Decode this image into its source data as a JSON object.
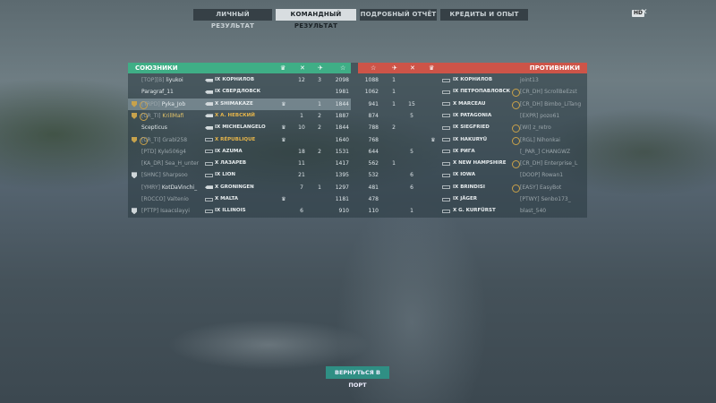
{
  "tabs": [
    {
      "label": "ЛИЧНЫЙ РЕЗУЛЬТАТ",
      "active": false
    },
    {
      "label": "КОМАНДНЫЙ РЕЗУЛЬТАТ",
      "active": true
    },
    {
      "label": "ПОДРОБНЫЙ ОТЧЁТ",
      "active": false
    },
    {
      "label": "КРЕДИТЫ И ОПЫТ",
      "active": false
    }
  ],
  "hd_label": "HD",
  "close_glyph": "✕",
  "allies_title": "СОЮЗНИКИ",
  "enemies_title": "ПРОТИВНИКИ",
  "column_icons": {
    "ribbons": "♛",
    "kills": "✕",
    "planes": "✈",
    "xp": "☆"
  },
  "allies": [
    {
      "clan": "[TOP][B]",
      "name": "liyukoi",
      "ship": "IX КОРНИЛОВ",
      "ribbons": "",
      "kills": "12",
      "planes": "3",
      "xp": "2098",
      "hl": false,
      "gold": false,
      "badge": "",
      "dim": false
    },
    {
      "clan": "",
      "name": "Paragraf_11",
      "ship": "IX СВЕРДЛОВСК",
      "ribbons": "",
      "kills": "",
      "planes": "",
      "xp": "1981",
      "hl": false,
      "gold": false,
      "badge": "",
      "dim": false
    },
    {
      "clan": "[TRPD]",
      "name": "Pyka_Job",
      "ship": "X SHIMAKAZE",
      "ribbons": "♛",
      "kills": "",
      "planes": "1",
      "xp": "1844",
      "hl": true,
      "gold": false,
      "badge": "shield",
      "dim": false
    },
    {
      "clan": "[CR_TI]",
      "name": "KrillMafi",
      "ship": "X A. НЕВСКИЙ",
      "ribbons": "",
      "kills": "1",
      "planes": "2",
      "xp": "1887",
      "hl": false,
      "gold": true,
      "badge": "shield",
      "dim": false
    },
    {
      "clan": "",
      "name": "Scepticus",
      "ship": "IX MICHELANGELO",
      "ribbons": "♛",
      "kills": "10",
      "planes": "2",
      "xp": "1844",
      "hl": false,
      "gold": false,
      "badge": "",
      "dim": false
    },
    {
      "clan": "[CR_TI]",
      "name": "Grabl258",
      "ship": "X RÉPUBLIQUE",
      "ribbons": "♛",
      "kills": "",
      "planes": "",
      "xp": "1640",
      "hl": false,
      "gold": true,
      "badge": "shield",
      "dim": true
    },
    {
      "clan": "[PTD]",
      "name": "Kyle506g4",
      "ship": "IX AZUMA",
      "ribbons": "",
      "kills": "18",
      "planes": "2",
      "xp": "1531",
      "hl": false,
      "gold": false,
      "badge": "",
      "dim": true
    },
    {
      "clan": "[KA_DR]",
      "name": "Sea_H_unter",
      "ship": "X ЛАЗАРЕВ",
      "ribbons": "",
      "kills": "11",
      "planes": "",
      "xp": "1417",
      "hl": false,
      "gold": false,
      "badge": "",
      "dim": true
    },
    {
      "clan": "[SHNC]",
      "name": "Sharpsoo",
      "ship": "IX LION",
      "ribbons": "",
      "kills": "21",
      "planes": "",
      "xp": "1395",
      "hl": false,
      "gold": false,
      "badge": "shieldw",
      "dim": true
    },
    {
      "clan": "[YMRY]",
      "name": "KotDaVinchi_",
      "ship": "X GRONINGEN",
      "ribbons": "",
      "kills": "7",
      "planes": "1",
      "xp": "1297",
      "hl": false,
      "gold": false,
      "badge": "",
      "dim": false
    },
    {
      "clan": "[ROCCO]",
      "name": "Valtenio",
      "ship": "X MALTA",
      "ribbons": "♛",
      "kills": "",
      "planes": "",
      "xp": "1181",
      "hl": false,
      "gold": false,
      "badge": "",
      "dim": true
    },
    {
      "clan": "[PTTP]",
      "name": "Isaacslayyi",
      "ship": "IX ILLINOIS",
      "ribbons": "",
      "kills": "6",
      "planes": "",
      "xp": "910",
      "hl": false,
      "gold": false,
      "badge": "shieldw",
      "dim": true
    }
  ],
  "enemies": [
    {
      "xp": "1088",
      "kills": "1",
      "planes": "",
      "ribbons": "",
      "ship": "IX КОРНИЛОВ",
      "clan": "",
      "name": "joint13"
    },
    {
      "xp": "1062",
      "kills": "1",
      "planes": "",
      "ribbons": "",
      "ship": "IX ПЕТРОПАВЛОВСК",
      "clan": "[CR_DH]",
      "name": "ScrollBeEzst"
    },
    {
      "xp": "941",
      "kills": "1",
      "planes": "15",
      "ribbons": "",
      "ship": "X MARCEAU",
      "clan": "[CR_DH]",
      "name": "Bimbo_LiTang"
    },
    {
      "xp": "874",
      "kills": "",
      "planes": "5",
      "ribbons": "",
      "ship": "IX PATAGONIA",
      "clan": "[EXPR]",
      "name": "pozo61"
    },
    {
      "xp": "788",
      "kills": "2",
      "planes": "",
      "ribbons": "",
      "ship": "IX SIEGFRIED",
      "clan": "[WI]",
      "name": "z_retro"
    },
    {
      "xp": "768",
      "kills": "",
      "planes": "",
      "ribbons": "♛",
      "ship": "IX HAKURYŪ",
      "clan": "[RGL]",
      "name": "Nihonkai"
    },
    {
      "xp": "644",
      "kills": "",
      "planes": "5",
      "ribbons": "",
      "ship": "IX РИГА",
      "clan": "[_PAR_]",
      "name": "CHANGWZ"
    },
    {
      "xp": "562",
      "kills": "1",
      "planes": "",
      "ribbons": "",
      "ship": "X NEW HAMPSHIRE",
      "clan": "[CR_DH]",
      "name": "Enterprise_L"
    },
    {
      "xp": "532",
      "kills": "",
      "planes": "6",
      "ribbons": "",
      "ship": "IX IOWA",
      "clan": "[DOOP]",
      "name": "Rowan1"
    },
    {
      "xp": "481",
      "kills": "",
      "planes": "6",
      "ribbons": "",
      "ship": "IX BRINDISI",
      "clan": "[EASY]",
      "name": "EasyBot"
    },
    {
      "xp": "478",
      "kills": "",
      "planes": "",
      "ribbons": "",
      "ship": "IX JÄGER",
      "clan": "[PTWY]",
      "name": "Senbo173_"
    },
    {
      "xp": "110",
      "kills": "",
      "planes": "1",
      "ribbons": "",
      "ship": "X G. KURFÜRST",
      "clan": "",
      "name": "blast_540"
    }
  ],
  "back_button": "ВЕРНУТЬСЯ В ПОРТ"
}
